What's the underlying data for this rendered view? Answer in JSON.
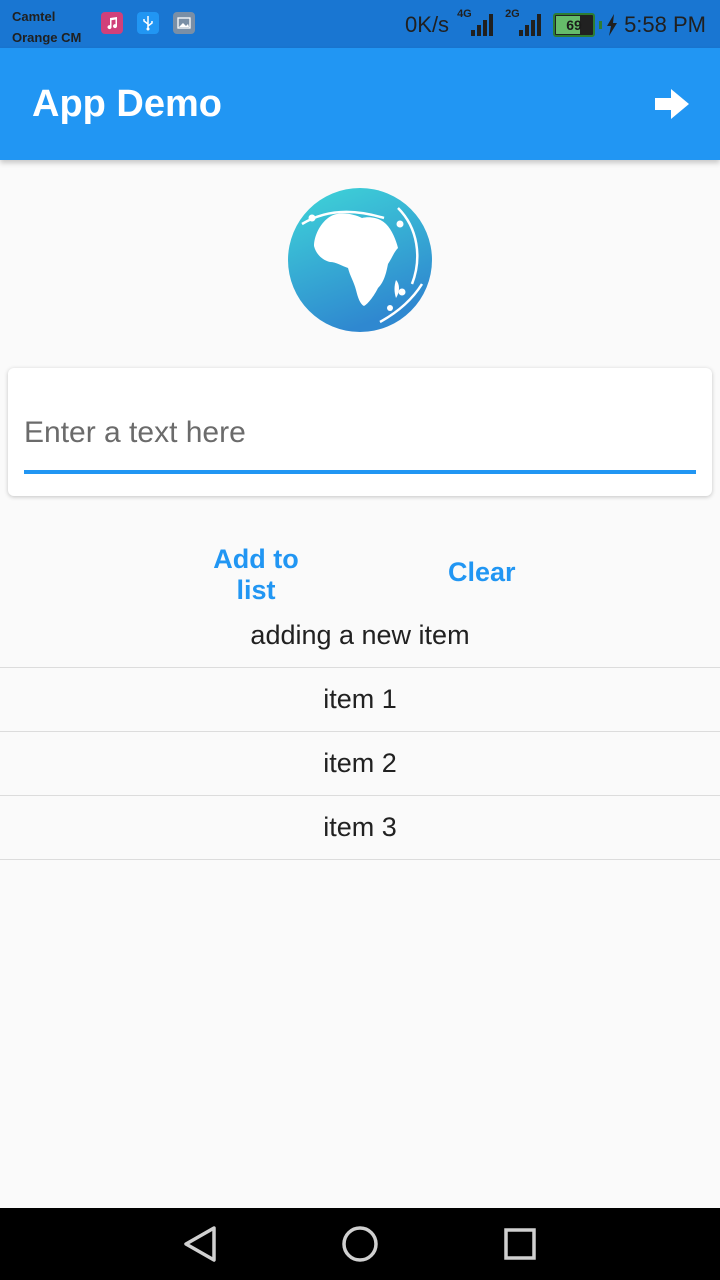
{
  "status_bar": {
    "carriers": [
      "Camtel",
      "Orange CM"
    ],
    "notification_icons": [
      "music-icon",
      "usb-icon",
      "photo-icon"
    ],
    "net_speed": "0K/s",
    "signal_1_label": "4G",
    "signal_2_label": "2G",
    "battery_level": "69",
    "time": "5:58 PM"
  },
  "app_bar": {
    "title": "App Demo",
    "action_icon": "arrow-forward-icon",
    "color": "#2196f3"
  },
  "logo": {
    "icon": "africa-globe-icon"
  },
  "input": {
    "placeholder": "Enter a text here",
    "value": ""
  },
  "buttons": {
    "add_label": "Add to list",
    "clear_label": "Clear",
    "accent_color": "#2196f3"
  },
  "list": {
    "items": [
      "adding a new item",
      "item 1",
      "item 2",
      "item 3"
    ]
  },
  "nav_bar": {
    "icons": [
      "back-icon",
      "home-icon",
      "recents-icon"
    ]
  }
}
